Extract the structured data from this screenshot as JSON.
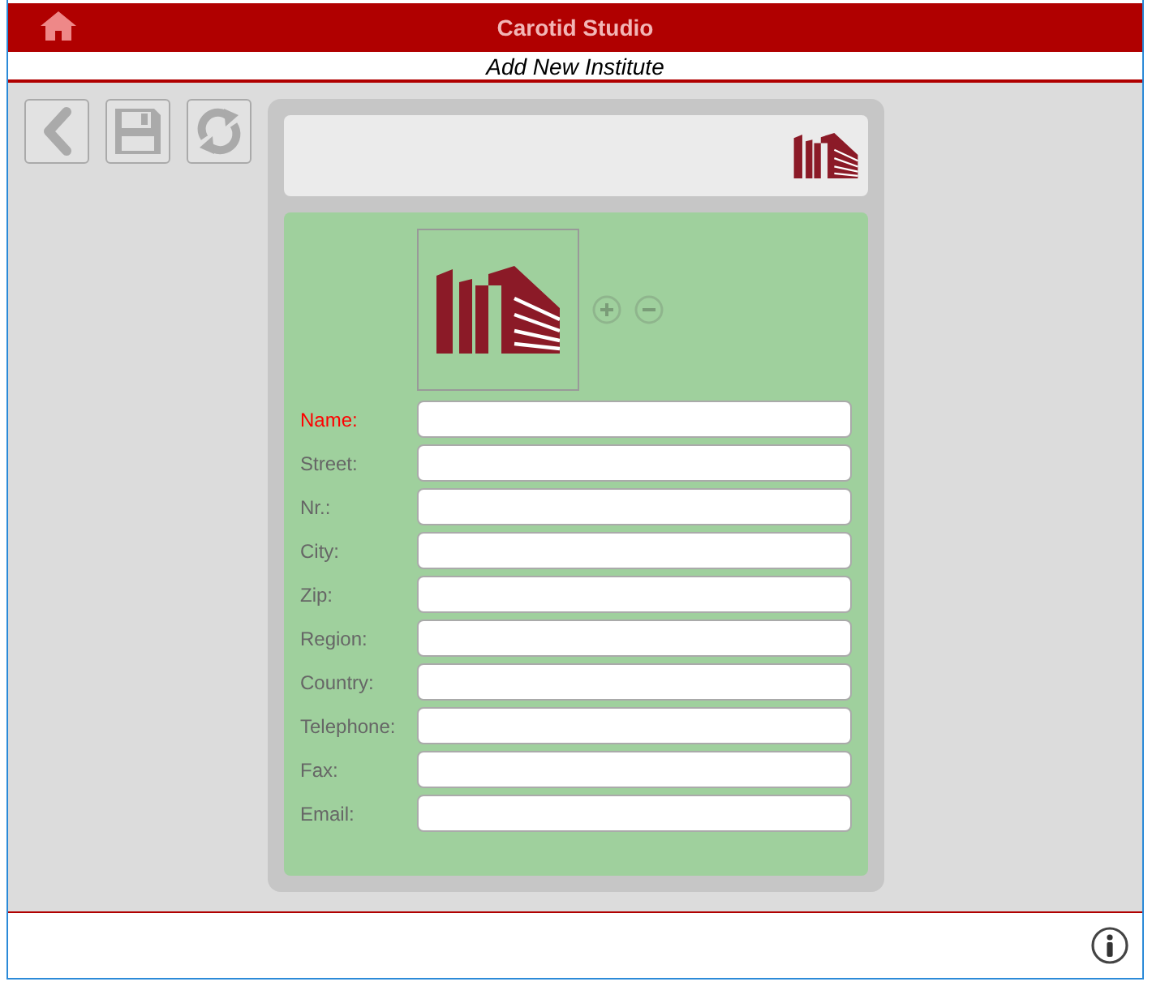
{
  "app_title": "Carotid Studio",
  "page_title": "Add New Institute",
  "fields": [
    {
      "label": "Name:",
      "required": true
    },
    {
      "label": "Street:",
      "required": false
    },
    {
      "label": "Nr.:",
      "required": false
    },
    {
      "label": "City:",
      "required": false
    },
    {
      "label": "Zip:",
      "required": false
    },
    {
      "label": "Region:",
      "required": false
    },
    {
      "label": "Country:",
      "required": false
    },
    {
      "label": "Telephone:",
      "required": false
    },
    {
      "label": "Fax:",
      "required": false
    },
    {
      "label": "Email:",
      "required": false
    }
  ]
}
